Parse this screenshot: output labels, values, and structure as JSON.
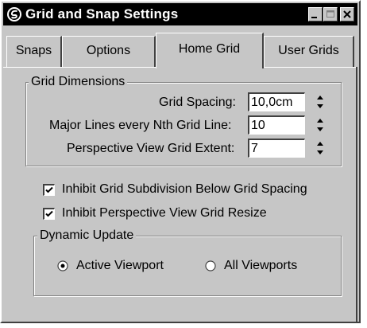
{
  "window": {
    "title": "Grid and Snap Settings",
    "app_icon": "3ds-max-logo-icon"
  },
  "title_buttons": [
    "minimize-icon",
    "maximize-icon",
    "close-icon"
  ],
  "tabs": [
    {
      "label": "Snaps",
      "active": false
    },
    {
      "label": "Options",
      "active": false
    },
    {
      "label": "Home Grid",
      "active": true
    },
    {
      "label": "User Grids",
      "active": false
    }
  ],
  "grid_dimensions": {
    "label": "Grid Dimensions",
    "grid_spacing": {
      "label": "Grid Spacing:",
      "value": "10,0cm"
    },
    "major_lines": {
      "label": "Major Lines every Nth Grid Line:",
      "value": "10"
    },
    "perspective_extent": {
      "label": "Perspective View Grid Extent:",
      "value": "7"
    }
  },
  "checkboxes": {
    "inhibit_subdivision": {
      "label": "Inhibit Grid Subdivision Below Grid Spacing",
      "checked": true
    },
    "inhibit_resize": {
      "label": "Inhibit Perspective View Grid Resize",
      "checked": true
    }
  },
  "dynamic_update": {
    "label": "Dynamic Update",
    "options": [
      {
        "label": "Active Viewport",
        "selected": true
      },
      {
        "label": "All Viewports",
        "selected": false
      }
    ]
  },
  "colors": {
    "face": "#c6c6c6",
    "titlebar": "#000000",
    "shadow": "#404040",
    "highlight": "#ffffff"
  }
}
